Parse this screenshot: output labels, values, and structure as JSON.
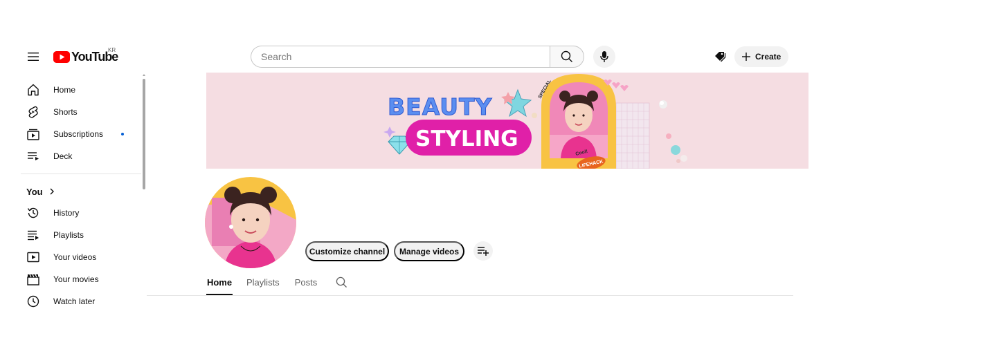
{
  "header": {
    "logo_text": "YouTube",
    "country_code": "KR",
    "search_placeholder": "Search",
    "create_label": "Create"
  },
  "sidebar": {
    "items": [
      {
        "label": "Home",
        "icon": "home-icon"
      },
      {
        "label": "Shorts",
        "icon": "shorts-icon"
      },
      {
        "label": "Subscriptions",
        "icon": "subscriptions-icon"
      },
      {
        "label": "Deck",
        "icon": "deck-icon"
      }
    ],
    "you_label": "You",
    "you_items": [
      {
        "label": "History",
        "icon": "history-icon"
      },
      {
        "label": "Playlists",
        "icon": "playlists-icon"
      },
      {
        "label": "Your videos",
        "icon": "your-videos-icon"
      },
      {
        "label": "Your movies",
        "icon": "your-movies-icon"
      },
      {
        "label": "Watch later",
        "icon": "watch-later-icon"
      }
    ]
  },
  "banner": {
    "line1": "BEAUTY",
    "line2": "STYLING",
    "sticker_special": "SPECIAL",
    "sticker_cool": "Cool!",
    "sticker_lifehack": "LIFEHACK"
  },
  "channel": {
    "customize_label": "Customize channel",
    "manage_label": "Manage videos",
    "tabs": [
      {
        "label": "Home",
        "active": true
      },
      {
        "label": "Playlists",
        "active": false
      },
      {
        "label": "Posts",
        "active": false
      }
    ]
  },
  "colors": {
    "brand_red": "#ff0000",
    "banner_bg": "#f5dde2",
    "beauty_blue": "#5b8ef0",
    "styling_magenta": "#e020a8",
    "frame_yellow": "#f8c343",
    "notification_dot": "#065fd4"
  }
}
